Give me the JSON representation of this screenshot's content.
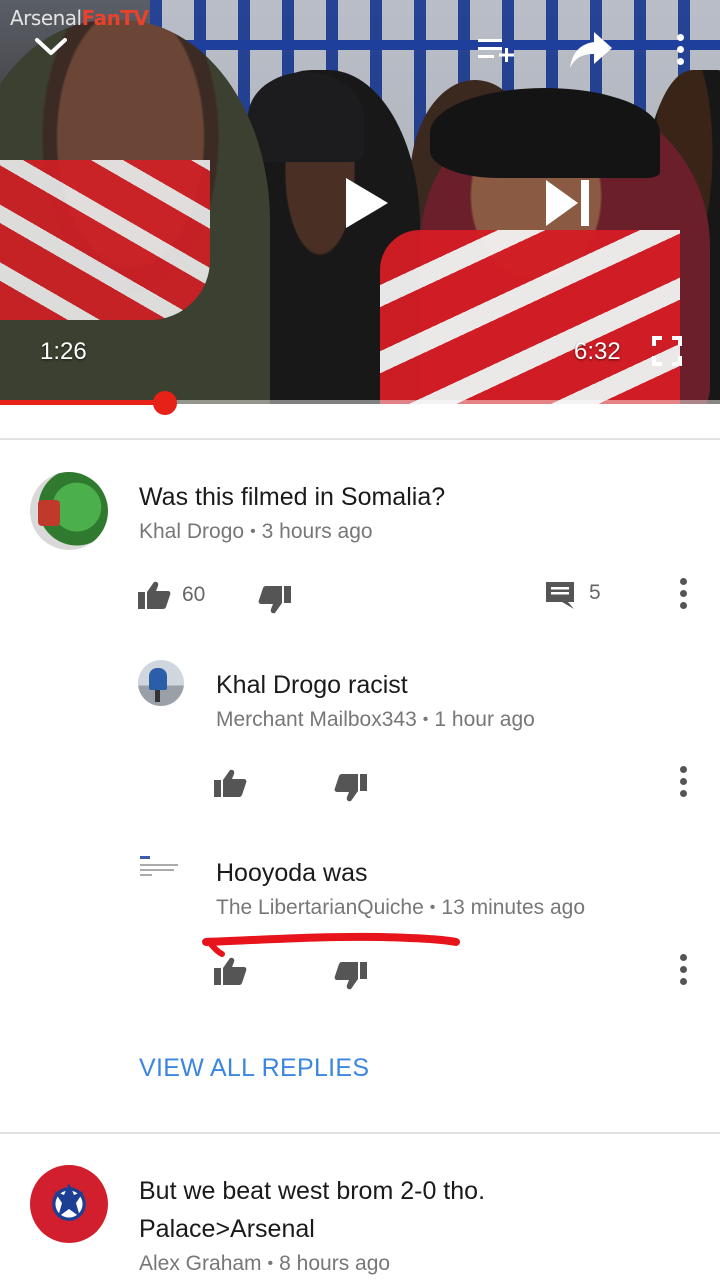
{
  "player": {
    "brand_left": "Arsenal",
    "brand_right": "FanTV",
    "current_time": "1:26",
    "duration": "6:32",
    "progress_fraction": 0.229,
    "icons": {
      "collapse": "chevron-down-icon",
      "add_to_queue": "add-to-playlist-icon",
      "share": "share-icon",
      "more": "more-vertical-icon",
      "play": "play-icon",
      "next": "skip-next-icon",
      "fullscreen": "fullscreen-icon"
    },
    "accent_color": "#e62117"
  },
  "comments": [
    {
      "text": "Was this filmed in Somalia?",
      "author": "Khal Drogo",
      "time": "3 hours ago",
      "likes": "60",
      "replies": "5"
    }
  ],
  "replies": [
    {
      "text": "Khal Drogo racist",
      "author": "Merchant Mailbox343",
      "time": "1 hour ago"
    },
    {
      "text": "Hooyoda was",
      "author": "The LibertarianQuiche",
      "time": "13 minutes ago"
    }
  ],
  "view_all_replies": "VIEW ALL REPLIES",
  "second_comment": {
    "text_line1": "But we beat west brom 2-0 tho.",
    "text_line2": "Palace>Arsenal",
    "author": "Alex Graham",
    "time": "8 hours ago"
  },
  "colors": {
    "link": "#3b86e0",
    "annotation": "#e8141b"
  }
}
